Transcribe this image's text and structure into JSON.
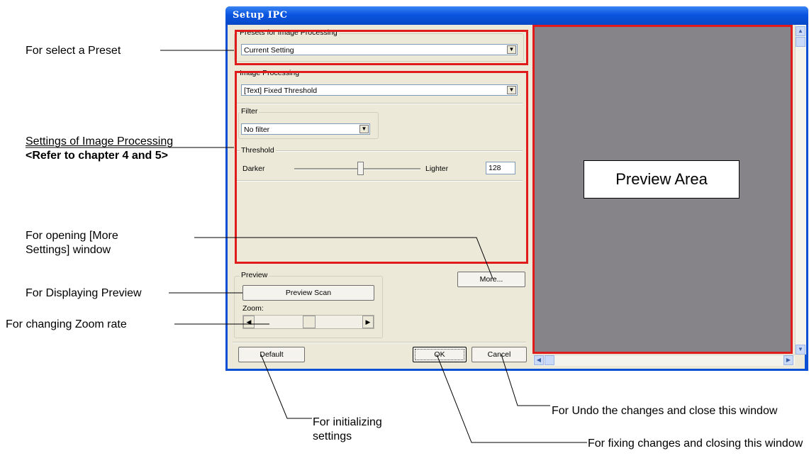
{
  "window": {
    "title": "Setup IPC",
    "presets": {
      "label": "Presets for Image Processing",
      "value": "Current Setting"
    },
    "image_processing": {
      "label": "Image Processing",
      "value": "[Text] Fixed Threshold"
    },
    "filter": {
      "label": "Filter",
      "value": "No filter"
    },
    "threshold": {
      "label": "Threshold",
      "left": "Darker",
      "right": "Lighter",
      "value": "128"
    },
    "more_button": "More...",
    "preview": {
      "label": "Preview",
      "scan_button": "Preview Scan",
      "zoom_label": "Zoom:"
    },
    "default_button": "Default",
    "ok_button": "OK",
    "cancel_button": "Cancel",
    "preview_area_label": "Preview Area"
  },
  "annotations": {
    "select_preset": "For select a Preset",
    "settings_line1": "Settings of Image Processing",
    "settings_line2": "<Refer to chapter 4 and 5>",
    "more_settings": "For opening [More Settings] window",
    "displaying_preview": "For Displaying Preview",
    "zoom_rate": "For changing Zoom rate",
    "initializing": "For initializing settings",
    "fixing": "For fixing changes and closing this window",
    "undo": "For Undo the changes and close this window"
  },
  "colors": {
    "highlight": "#e01b1b",
    "titlebar": "#0a55e0",
    "preview_bg": "#868488",
    "dialog_bg": "#ece9d8"
  }
}
